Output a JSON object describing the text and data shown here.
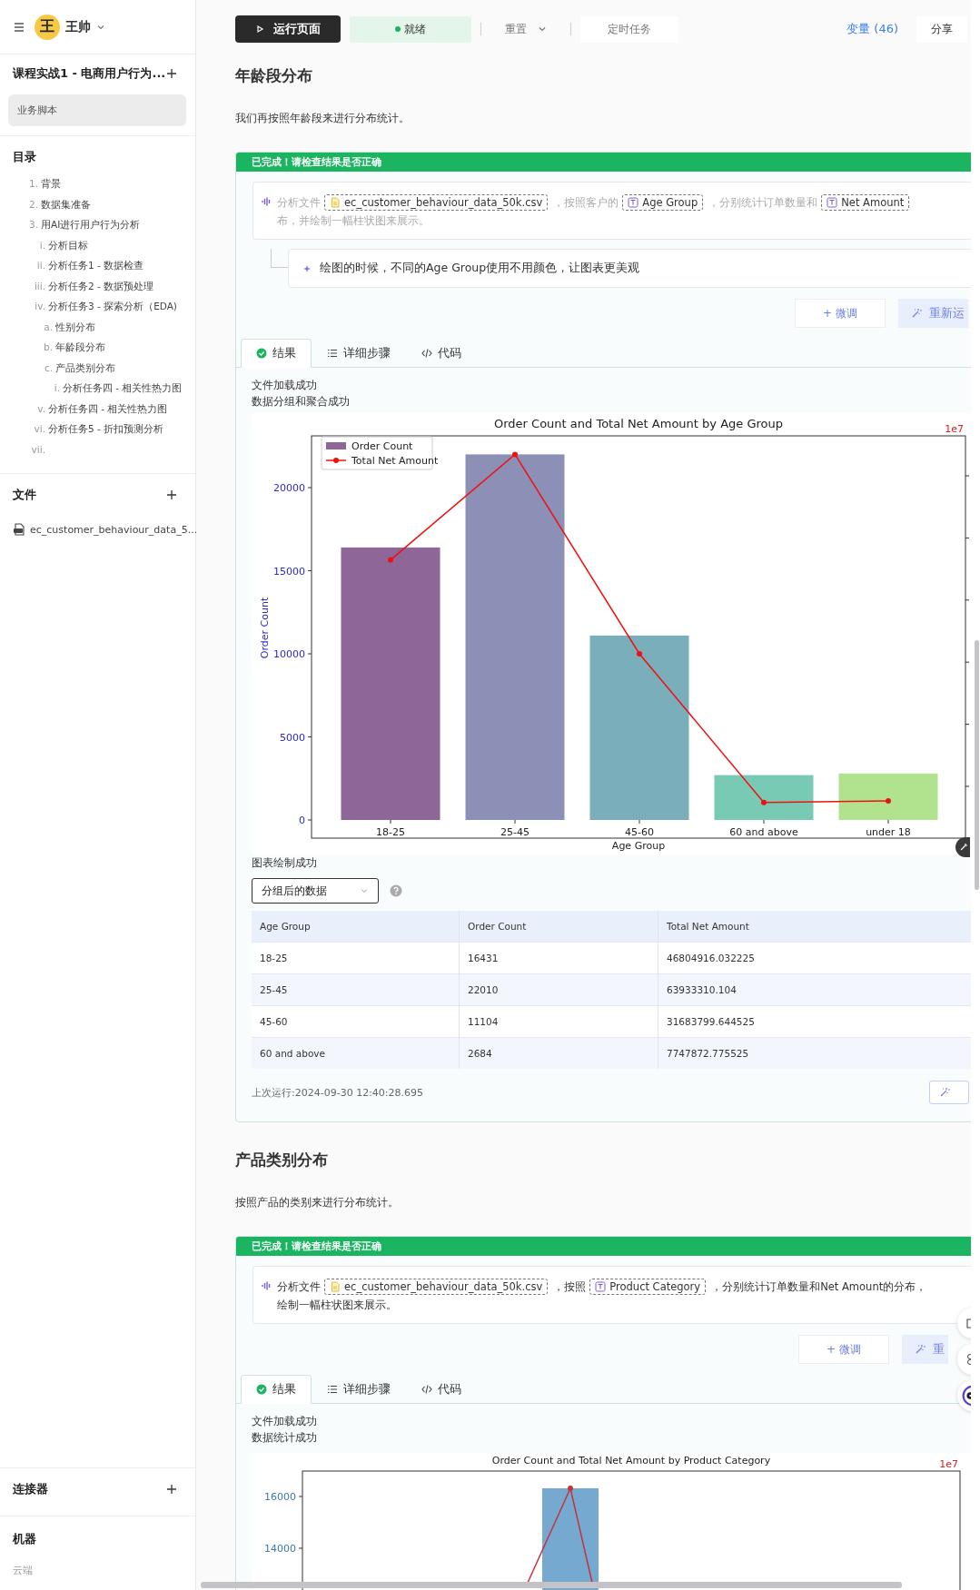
{
  "sidebar": {
    "user": {
      "avatar_text": "王",
      "name": "王帅"
    },
    "project": {
      "title": "课程实战1 - 电商用户行为...",
      "script": "业务脚本"
    },
    "toc": {
      "title": "目录",
      "items": [
        {
          "marker": "1.",
          "label": "背景"
        },
        {
          "marker": "2.",
          "label": "数据集准备"
        },
        {
          "marker": "3.",
          "label": "用AI进行用户行为分析",
          "children": [
            {
              "marker": "i.",
              "label": "分析目标"
            },
            {
              "marker": "ii.",
              "label": "分析任务1 - 数据检查"
            },
            {
              "marker": "iii.",
              "label": "分析任务2 - 数据预处理"
            },
            {
              "marker": "iv.",
              "label": "分析任务3 - 探索分析（EDA)",
              "children": [
                {
                  "marker": "a.",
                  "label": "性别分布"
                },
                {
                  "marker": "b.",
                  "label": "年龄段分布"
                },
                {
                  "marker": "c.",
                  "label": "产品类别分布",
                  "children": [
                    {
                      "marker": "i.",
                      "label": "分析任务四 - 相关性热力图"
                    }
                  ]
                }
              ]
            },
            {
              "marker": "v.",
              "label": "分析任务四 - 相关性热力图"
            },
            {
              "marker": "vi.",
              "label": "分析任务5 - 折扣预测分析"
            },
            {
              "marker": "vii."
            }
          ]
        }
      ]
    },
    "files": {
      "title": "文件",
      "items": [
        "ec_customer_behaviour_data_5..."
      ]
    },
    "connectors": {
      "title": "连接器"
    },
    "machine": {
      "title": "机器",
      "value": "云端"
    }
  },
  "toolbar": {
    "run": "运行页面",
    "status": "就绪",
    "reset": "重置",
    "schedule": "定时任务",
    "variables": "变量 (46)",
    "share": "分享"
  },
  "sections": [
    {
      "heading": "年龄段分布",
      "description": "我们再按照年龄段来进行分布统计。",
      "card": {
        "banner": "已完成！请检查结果是否正确",
        "prompt": {
          "dimmed": true,
          "lines": [
            [
              {
                "kind": "text",
                "text": "分析文件"
              },
              {
                "kind": "file",
                "text": "ec_customer_behaviour_data_50k.csv"
              },
              {
                "kind": "text",
                "text": "，按照客户的"
              },
              {
                "kind": "column",
                "text": "Age Group"
              },
              {
                "kind": "text",
                "text": "，分别统计订单数量和"
              },
              {
                "kind": "column",
                "text": "Net Amount"
              }
            ],
            [
              {
                "kind": "text",
                "text": "布，并绘制一幅柱状图来展示。"
              }
            ]
          ]
        },
        "followup": "绘图的时候，不同的Age Group使用不用颜色，让图表更美观",
        "buttons": {
          "tune": "+ 微调",
          "rerun": "重新运"
        },
        "tabs": [
          {
            "label": "结果",
            "selected": true
          },
          {
            "label": "详细步骤",
            "selected": false
          },
          {
            "label": "代码",
            "selected": false
          }
        ],
        "output": [
          "文件加载成功",
          "数据分组和聚合成功"
        ],
        "chart_data": {
          "type": "bar",
          "title": "Order Count and Total Net Amount by Age Group",
          "xlabel": "Age Group",
          "ylabel": "Order Count",
          "categories": [
            "18-25",
            "25-45",
            "45-60",
            "60 and above",
            "under 18"
          ],
          "legend": "upper left",
          "ylim": [
            0,
            23115
          ],
          "yticks": [
            0,
            5000,
            10000,
            15000,
            20000
          ],
          "series": [
            {
              "name": "Order Count",
              "type": "bar",
              "color": "#8e6698",
              "colors": [
                "#8e6698",
                "#8c8fb6",
                "#7aaeba",
                "#79cab4",
                "#b1e38f"
              ],
              "values": [
                16400,
                22000,
                11100,
                2700,
                2800
              ]
            },
            {
              "name": "Total Net Amount",
              "type": "line",
              "color": "#ee1111",
              "marker": "o",
              "values": [
                15650,
                22000,
                10000,
                1050,
                1150
              ]
            }
          ],
          "annotations": [
            {
              "text": "1e7"
            }
          ]
        },
        "after": "图表绘制成功",
        "table_select": "分组后的数据",
        "table": {
          "columns": [
            "Age Group",
            "Order Count",
            "Total Net Amount"
          ],
          "rows": [
            [
              "18-25",
              "16431",
              "46804916.032225"
            ],
            [
              "25-45",
              "22010",
              "63933310.104"
            ],
            [
              "45-60",
              "11104",
              "31683799.644525"
            ],
            [
              "60 and above",
              "2684",
              "7747872.775525"
            ]
          ]
        },
        "last_run": "上次运行:2024-09-30 12:40:28.695"
      }
    },
    {
      "heading": "产品类别分布",
      "description": "按照产品的类别来进行分布统计。",
      "card": {
        "banner": "已完成！请检查结果是否正确",
        "prompt": {
          "dimmed": false,
          "lines": [
            [
              {
                "kind": "text",
                "text": "分析文件"
              },
              {
                "kind": "file",
                "text": "ec_customer_behaviour_data_50k.csv"
              },
              {
                "kind": "text",
                "text": "，按照"
              },
              {
                "kind": "column",
                "text": "Product Category"
              },
              {
                "kind": "text",
                "text": "，分别统计订单数量和Net Amount的分布，"
              }
            ],
            [
              {
                "kind": "text",
                "text": "绘制一幅柱状图来展示。"
              }
            ]
          ]
        },
        "buttons": {
          "tune": "+ 微调",
          "rerun": "重"
        },
        "tabs": [
          {
            "label": "结果",
            "selected": true
          },
          {
            "label": "详细步骤",
            "selected": false
          },
          {
            "label": "代码",
            "selected": false
          }
        ],
        "output": [
          "文件加载成功",
          "数据统计成功"
        ],
        "chart_picture": {
          "title": "Order Count and Total Net Amount by Product Category",
          "tick_labels": [
            "16000",
            "14000"
          ],
          "scale_label": "1e7"
        }
      }
    }
  ]
}
